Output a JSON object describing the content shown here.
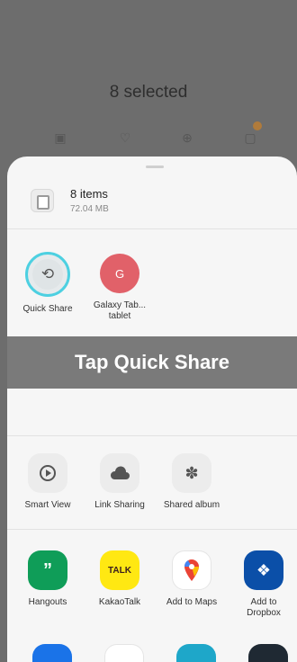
{
  "background": {
    "title": "8 selected",
    "icons": [
      "gallery-icon",
      "heart-icon",
      "plus-icon",
      "message-icon"
    ]
  },
  "file_info": {
    "count": "8 items",
    "size": "72.04 MB"
  },
  "quick_targets": [
    {
      "label": "Quick Share",
      "icon": "quick-share-icon"
    },
    {
      "label": "Galaxy Tab... tablet",
      "initial": "G",
      "icon": "device-avatar"
    }
  ],
  "overlay": {
    "text": "Tap Quick Share"
  },
  "share_options": [
    {
      "label": "Smart View",
      "icon": "smart-view-icon"
    },
    {
      "label": "Link Sharing",
      "icon": "cloud-share-icon"
    },
    {
      "label": "Shared album",
      "icon": "shared-album-icon"
    }
  ],
  "apps": [
    {
      "label": "Hangouts",
      "icon": "hangouts-icon",
      "color": "#0f9d58"
    },
    {
      "label": "KakaoTalk",
      "icon": "kakaotalk-icon",
      "badge": "TALK",
      "color": "#ffe812"
    },
    {
      "label": "Add to Maps",
      "icon": "maps-icon"
    },
    {
      "label": "Add to Dropbox",
      "icon": "dropbox-icon",
      "color": "#0b4fa8"
    }
  ],
  "colors": {
    "accent_ring": "#4dd0e1",
    "avatar": "#e16169",
    "overlay": "#7a7a7a"
  }
}
